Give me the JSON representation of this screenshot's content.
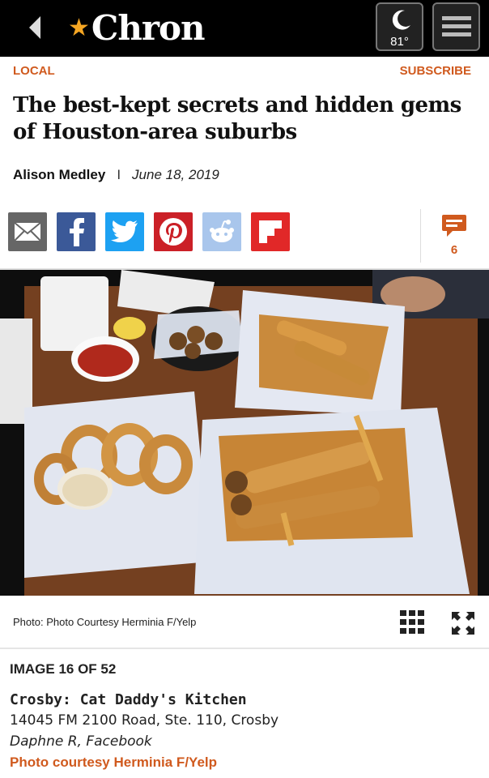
{
  "header": {
    "logo_text": "Chron",
    "logo_star": "★",
    "temperature": "81°",
    "icons": [
      "back-arrow-icon",
      "moon-icon",
      "hamburger-menu-icon"
    ]
  },
  "section": {
    "label": "LOCAL",
    "subscribe": "SUBSCRIBE"
  },
  "article": {
    "headline": "The best-kept secrets and hidden gems of Houston-area suburbs",
    "author": "Alison Medley",
    "separator": "I",
    "date": "June 18, 2019"
  },
  "share": {
    "icons": [
      "email-icon",
      "facebook-icon",
      "twitter-icon",
      "pinterest-icon",
      "reddit-icon",
      "flipboard-icon"
    ],
    "comment_count": "6"
  },
  "photo": {
    "caption": "Photo: Photo Courtesy Herminia F/Yelp"
  },
  "gallery": {
    "image_count": "IMAGE 16 OF 52",
    "title": "Crosby: Cat Daddy's Kitchen",
    "address": "14045 FM 2100 Road, Ste. 110, Crosby",
    "credit_line": "Daphne R, Facebook",
    "photo_credit": "Photo courtesy Herminia F/Yelp"
  },
  "colors": {
    "accent": "#d05a1e",
    "header_bg": "#000000",
    "facebook": "#3b5998",
    "twitter": "#1da1f2",
    "pinterest": "#cb2027",
    "flipboard": "#e12828"
  }
}
